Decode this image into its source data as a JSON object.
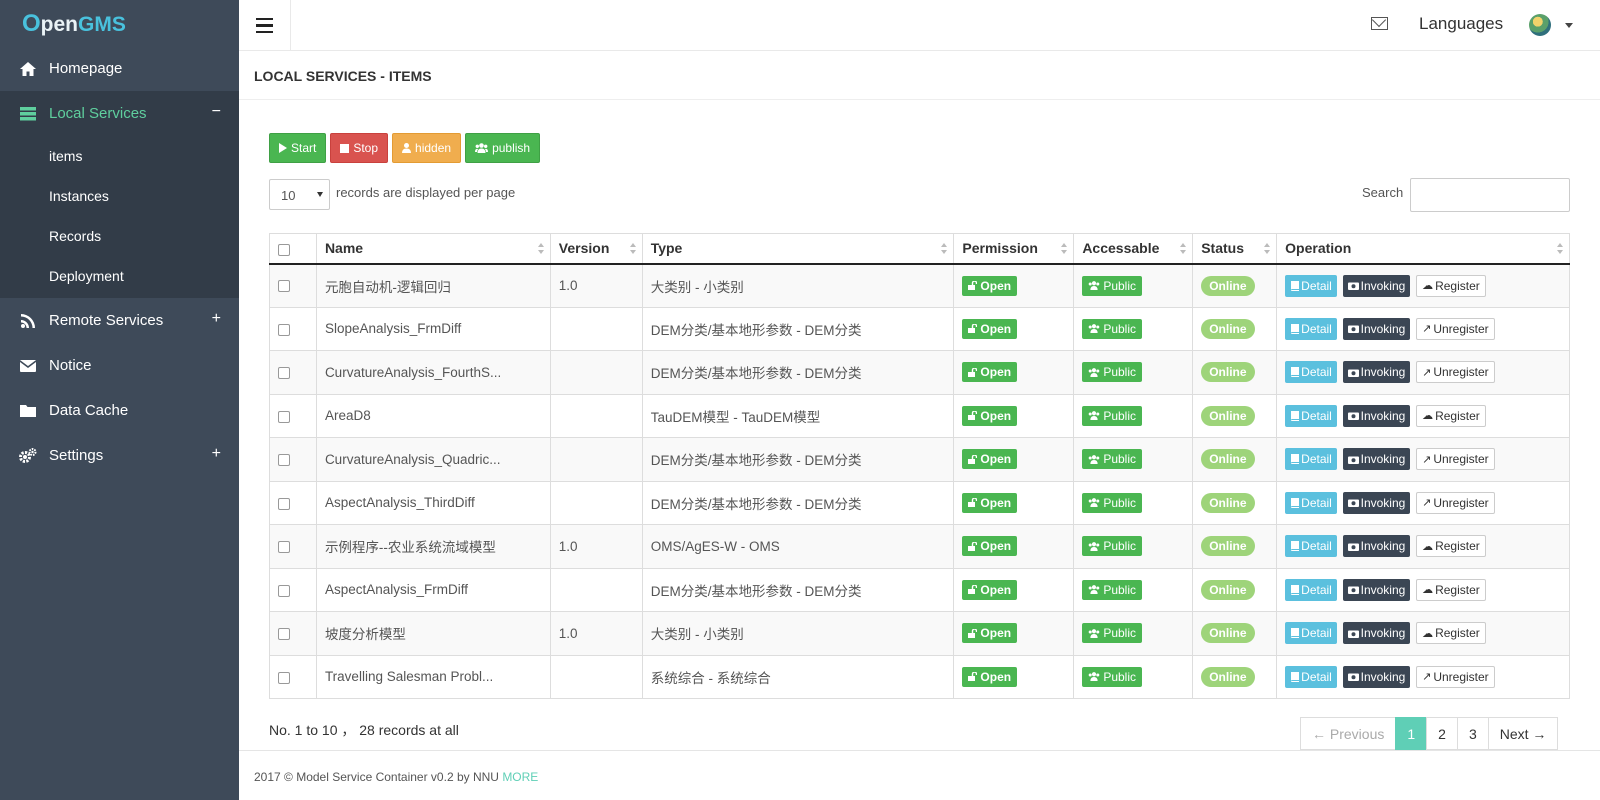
{
  "app": {
    "logo_o": "O",
    "logo_pen": "pen",
    "logo_gms": "GMS"
  },
  "sidebar": {
    "items": [
      {
        "label": "Homepage",
        "icon": "home-icon"
      },
      {
        "label": "Local Services",
        "icon": "server-icon",
        "toggle": "−",
        "expanded": true,
        "sub_items": [
          "items",
          "Instances",
          "Records",
          "Deployment"
        ]
      },
      {
        "label": "Remote Services",
        "icon": "rss-icon",
        "toggle": "+"
      },
      {
        "label": "Notice",
        "icon": "envelope-icon"
      },
      {
        "label": "Data Cache",
        "icon": "folder-icon"
      },
      {
        "label": "Settings",
        "icon": "cogs-icon",
        "toggle": "+"
      }
    ]
  },
  "topbar": {
    "languages": "Languages"
  },
  "page": {
    "title": "LOCAL SERVICES - ITEMS"
  },
  "actions": {
    "start": "Start",
    "stop": "Stop",
    "hidden": "hidden",
    "publish": "publish"
  },
  "length": {
    "value": "10",
    "text": "records are displayed per page"
  },
  "search": {
    "label": "Search"
  },
  "table": {
    "headers": [
      "Name",
      "Version",
      "Type",
      "Permission",
      "Accessable",
      "Status",
      "Operation"
    ],
    "rows": [
      {
        "name": "元胞自动机-逻辑回归",
        "version": "1.0",
        "type": "大类别 - 小类别",
        "permission": "Open",
        "access": "Public",
        "status": "Online",
        "reg": "Register"
      },
      {
        "name": "SlopeAnalysis_FrmDiff",
        "version": "",
        "type": "DEM分类/基本地形参数 - DEM分类",
        "permission": "Open",
        "access": "Public",
        "status": "Online",
        "reg": "Unregister"
      },
      {
        "name": "CurvatureAnalysis_FourthS...",
        "version": "",
        "type": "DEM分类/基本地形参数 - DEM分类",
        "permission": "Open",
        "access": "Public",
        "status": "Online",
        "reg": "Unregister"
      },
      {
        "name": "AreaD8",
        "version": "",
        "type": "TauDEM模型 - TauDEM模型",
        "permission": "Open",
        "access": "Public",
        "status": "Online",
        "reg": "Register"
      },
      {
        "name": "CurvatureAnalysis_Quadric...",
        "version": "",
        "type": "DEM分类/基本地形参数 - DEM分类",
        "permission": "Open",
        "access": "Public",
        "status": "Online",
        "reg": "Unregister"
      },
      {
        "name": "AspectAnalysis_ThirdDiff",
        "version": "",
        "type": "DEM分类/基本地形参数 - DEM分类",
        "permission": "Open",
        "access": "Public",
        "status": "Online",
        "reg": "Unregister"
      },
      {
        "name": "示例程序--农业系统流域模型",
        "version": "1.0",
        "type": "OMS/AgES-W - OMS",
        "permission": "Open",
        "access": "Public",
        "status": "Online",
        "reg": "Register"
      },
      {
        "name": "AspectAnalysis_FrmDiff",
        "version": "",
        "type": "DEM分类/基本地形参数 - DEM分类",
        "permission": "Open",
        "access": "Public",
        "status": "Online",
        "reg": "Register"
      },
      {
        "name": "坡度分析模型",
        "version": "1.0",
        "type": "大类别 - 小类别",
        "permission": "Open",
        "access": "Public",
        "status": "Online",
        "reg": "Register"
      },
      {
        "name": "Travelling Salesman Probl...",
        "version": "",
        "type": "系统综合 - 系统综合",
        "permission": "Open",
        "access": "Public",
        "status": "Online",
        "reg": "Unregister"
      }
    ],
    "detail_label": "Detail",
    "invoking_label": "Invoking"
  },
  "info": {
    "text": "No. 1 to 10 ， 28 records at all"
  },
  "pager": {
    "previous": "← Previous",
    "pages": [
      "1",
      "2",
      "3"
    ],
    "current": "1",
    "next": "Next →"
  },
  "footer": {
    "text": "2017 © Model Service Container v0.2 by NNU",
    "link": "MORE"
  },
  "colors": {
    "sidebar_bg": "#3e4a59",
    "accent": "#5fcf9e",
    "success": "#4ab651",
    "danger": "#d9534f",
    "warning": "#f0ad4e",
    "info": "#5bc0de"
  }
}
